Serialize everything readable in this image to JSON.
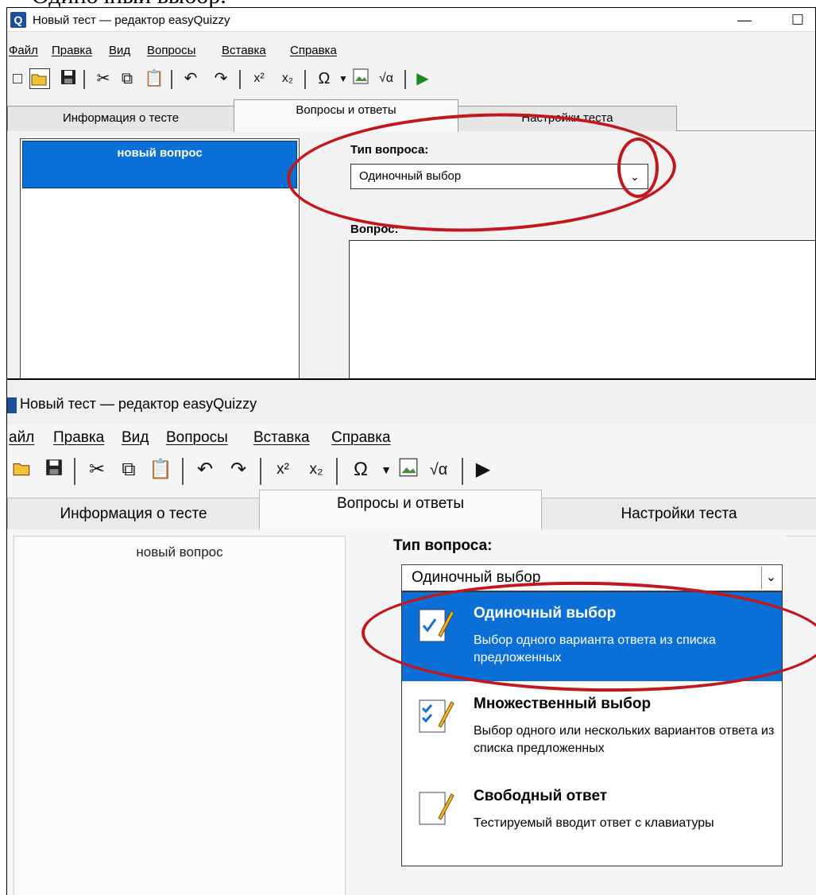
{
  "caption": "Одиночный выбор.",
  "window": {
    "app_icon_letter": "Q",
    "title": "Новый тест — редактор easyQuizzy",
    "minimize": "—",
    "maximize": "☐"
  },
  "menu": [
    "Файл",
    "Правка",
    "Вид",
    "Вопросы",
    "Вставка",
    "Справка"
  ],
  "menu_cropped_first": "айл",
  "toolbar_icons": [
    "new-document-icon",
    "open-folder-icon",
    "save-icon",
    "cut-icon",
    "copy-icon",
    "paste-icon",
    "undo-icon",
    "redo-icon",
    "superscript-icon",
    "subscript-icon",
    "omega-symbol-icon",
    "insert-image-icon",
    "formula-icon",
    "run-test-icon"
  ],
  "tabs": [
    "Информация о тесте",
    "Вопросы и ответы",
    "Настройки теста"
  ],
  "active_tab": "Вопросы и ответы",
  "question_list": {
    "items": [
      "новый вопрос"
    ]
  },
  "question_type": {
    "label": "Тип вопроса:",
    "value": "Одиночный выбор"
  },
  "question_text_label": "Вопрос:",
  "dropdown_options": [
    {
      "title": "Одиночный выбор",
      "desc": "Выбор одного варианта ответа из списка предложенных",
      "icon": "single-choice-icon",
      "selected": true
    },
    {
      "title": "Множественный выбор",
      "desc": "Выбор одного или нескольких вариантов ответа из списка предложенных",
      "icon": "multiple-choice-icon",
      "selected": false
    },
    {
      "title": "Свободный ответ",
      "desc": "Тестируемый вводит ответ с клавиатуры",
      "icon": "free-answer-icon",
      "selected": false
    }
  ],
  "colors": {
    "selection_blue": "#0a6fd6",
    "annotation_red": "#c0181c"
  }
}
